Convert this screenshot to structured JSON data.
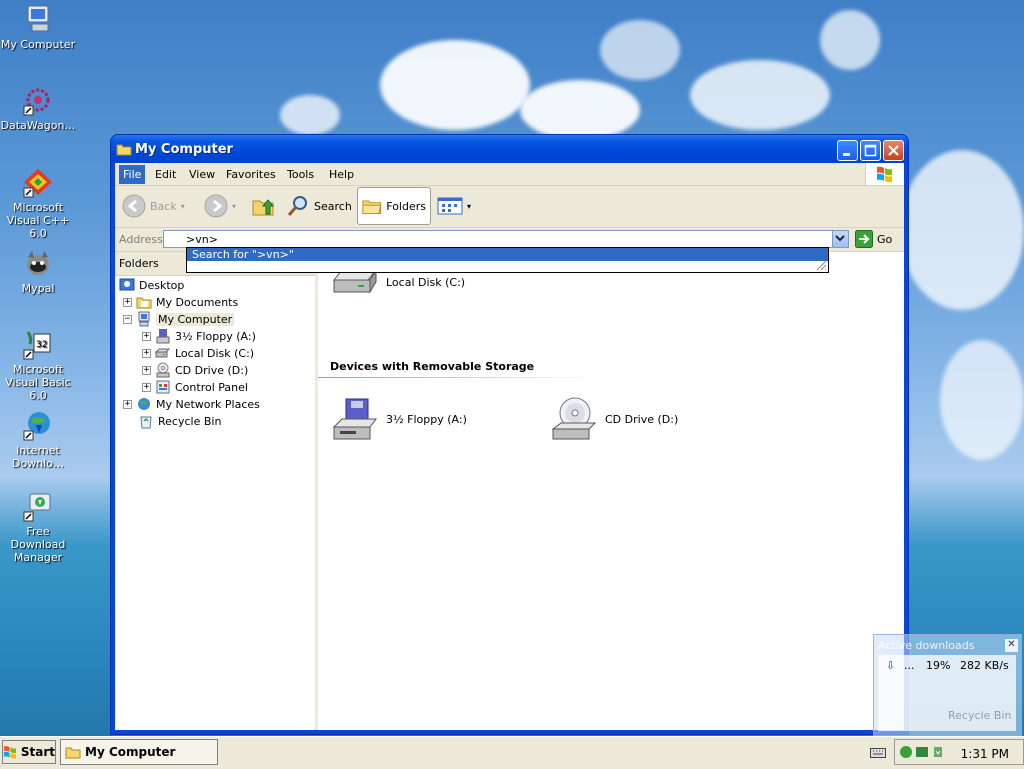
{
  "desktop": {
    "icons": [
      {
        "label": "My Computer",
        "icon": "my-computer-icon"
      },
      {
        "label": "DataWagon…",
        "icon": "datawagon-icon"
      },
      {
        "label": "Microsoft Visual C++ 6.0",
        "icon": "visual-cpp-icon"
      },
      {
        "label": "Mypal",
        "icon": "mypal-icon"
      },
      {
        "label": "Microsoft Visual Basic 6.0",
        "icon": "visual-basic-icon"
      },
      {
        "label": "Internet Downlo…",
        "icon": "internet-download-icon"
      },
      {
        "label": "Free Download Manager",
        "icon": "fdm-icon"
      }
    ]
  },
  "window": {
    "title": "My Computer",
    "menu": [
      "File",
      "Edit",
      "View",
      "Favorites",
      "Tools",
      "Help"
    ],
    "toolbar": {
      "back": "Back",
      "search": "Search",
      "folders": "Folders"
    },
    "address": {
      "label": "Address",
      "value": ">vn>",
      "go": "Go",
      "suggestion": "Search for \">vn>\""
    },
    "folders_panel": {
      "title": "Folders",
      "tree": [
        {
          "label": "Desktop",
          "expander": "",
          "icon": "desktop-icon"
        },
        {
          "label": "My Documents",
          "expander": "+",
          "icon": "my-documents-icon"
        },
        {
          "label": "My Computer",
          "expander": "−",
          "icon": "my-computer-icon",
          "selected": true
        },
        {
          "label": "3½ Floppy (A:)",
          "expander": "+",
          "icon": "floppy-drive-icon"
        },
        {
          "label": "Local Disk (C:)",
          "expander": "+",
          "icon": "hard-disk-icon"
        },
        {
          "label": "CD Drive (D:)",
          "expander": "+",
          "icon": "cd-drive-icon"
        },
        {
          "label": "Control Panel",
          "expander": "+",
          "icon": "control-panel-icon"
        },
        {
          "label": "My Network Places",
          "expander": "+",
          "icon": "network-places-icon"
        },
        {
          "label": "Recycle Bin",
          "expander": "",
          "icon": "recycle-bin-icon"
        }
      ]
    },
    "content": {
      "hard_disks": [
        {
          "label": "Local Disk (C:)",
          "icon": "hard-disk-icon"
        }
      ],
      "removable_header": "Devices with Removable Storage",
      "removable": [
        {
          "label": "3½ Floppy (A:)",
          "icon": "floppy-drive-icon"
        },
        {
          "label": "CD Drive (D:)",
          "icon": "cd-drive-icon"
        }
      ]
    }
  },
  "taskbar": {
    "start": "Start",
    "task": "My Computer",
    "clock": "1:31 PM"
  },
  "downloads_popup": {
    "title": "Active downloads",
    "name": "...",
    "percent": "19%",
    "speed": "282 KB/s",
    "faded_label": "Recycle Bin"
  }
}
